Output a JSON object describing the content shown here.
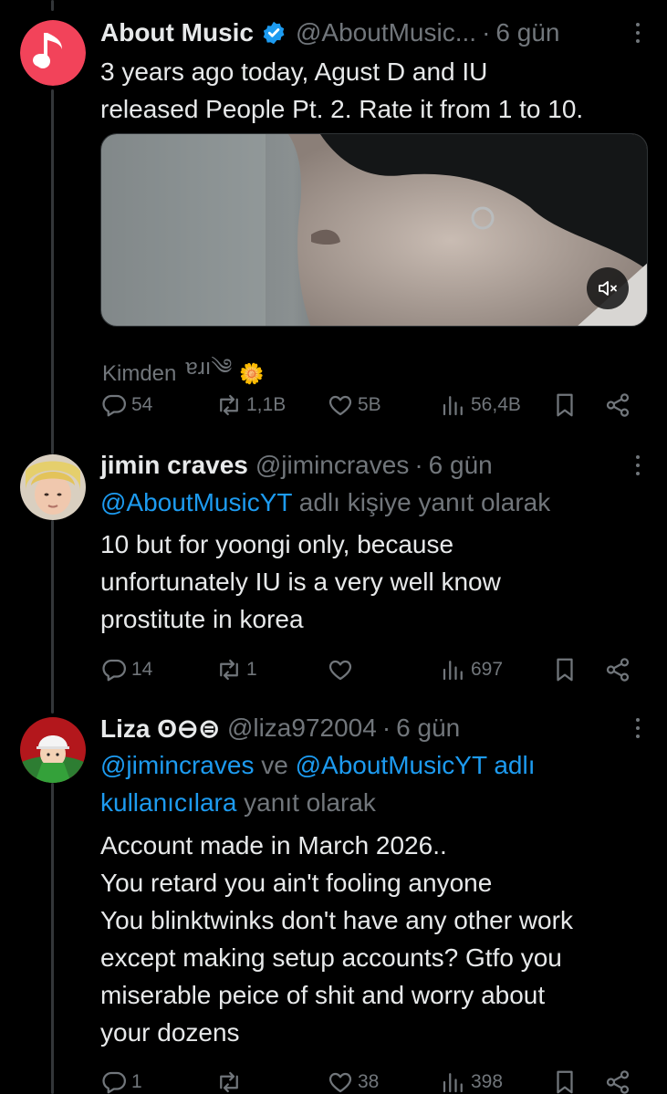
{
  "tweets": [
    {
      "name": "About Music",
      "handle": "@AboutMusic...",
      "time": "6 gün",
      "text": "3 years ago today, Agust D and IU\nreleased People Pt. 2. Rate it from 1 to 10.",
      "from_label": "Kimden",
      "from_user": "ɐɹı༄",
      "from_emoji": "🌼",
      "stats": {
        "replies": "54",
        "reposts": "1,1B",
        "likes": "5B",
        "views": "56,4B"
      }
    },
    {
      "name": "jimin craves",
      "handle": "@jimincraves",
      "time": "6 gün",
      "reply_mention": "@AboutMusicYT",
      "reply_suffix": " adlı kişiye yanıt olarak",
      "text": "10 but for yoongi only, because\nunfortunately IU is a very well know\nprostitute in korea",
      "stats": {
        "replies": "14",
        "reposts": "1",
        "likes": "",
        "views": "697"
      }
    },
    {
      "name": "Liza ʘ⊖⊜",
      "handle": "@liza972004",
      "time": "6 gün",
      "reply_mention_1": "@jimincraves",
      "reply_joiner": " ve ",
      "reply_mention_2": "@AboutMusicYT adlı kullanıcılara",
      "reply_suffix": " yanıt olarak",
      "text": "Account made in March 2026..\nYou retard you ain't fooling anyone\nYou blinktwinks don't have any other work\nexcept making setup accounts? Gtfo you\nmiserable peice of shit and worry about\nyour dozens",
      "stats": {
        "replies": "1",
        "reposts": "",
        "likes": "38",
        "views": "398"
      }
    }
  ],
  "colors": {
    "background": "#000000",
    "text": "#e7e9ea",
    "muted": "#71767b",
    "link": "#1d9bf0",
    "verified": "#1d9bf0",
    "brand_avatar": "#f2435a"
  },
  "icons": [
    "music-note-icon",
    "verified-badge-icon",
    "more-icon",
    "mute-icon",
    "reply-icon",
    "repost-icon",
    "like-icon",
    "views-icon",
    "bookmark-icon",
    "share-icon"
  ]
}
